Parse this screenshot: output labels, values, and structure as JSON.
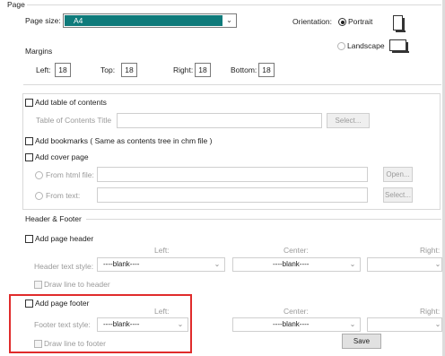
{
  "page": {
    "group_title": "Page",
    "page_size_label": "Page size:",
    "page_size_value": "A4",
    "orientation_label": "Orientation:",
    "portrait_label": "Portrait",
    "landscape_label": "Landscape",
    "margins_label": "Margins",
    "left_label": "Left:",
    "left_value": "18",
    "top_label": "Top:",
    "top_value": "18",
    "right_label": "Right:",
    "right_value": "18",
    "bottom_label": "Bottom:",
    "bottom_value": "18"
  },
  "toc": {
    "checkbox_label": "Add table of contents",
    "title_label": "Table of Contents Title",
    "select_button": "Select..."
  },
  "bookmarks": {
    "checkbox_label": "Add  bookmarks ( Same as contents tree in chm file )"
  },
  "cover": {
    "checkbox_label": "Add cover page",
    "from_html_label": "From html file:",
    "open_button": "Open...",
    "from_text_label": "From  text:",
    "select_button": "Select..."
  },
  "header_footer": {
    "group_title": "Header & Footer",
    "header_checkbox": "Add page header",
    "left_col": "Left:",
    "center_col": "Center:",
    "right_col": "Right:",
    "header_style_label": "Header text style:",
    "header_left_value": "----blank----",
    "header_center_value": "----blank----",
    "header_draw_line": "Draw line to header",
    "footer_checkbox": "Add page footer",
    "footer_style_label": "Footer text style:",
    "footer_left_value": "----blank----",
    "footer_center_value": "----blank----",
    "footer_draw_line": "Draw line to footer"
  },
  "save_button": "Save",
  "colors": {
    "selection": "#0f7b7b",
    "highlight": "#e02b2b"
  }
}
